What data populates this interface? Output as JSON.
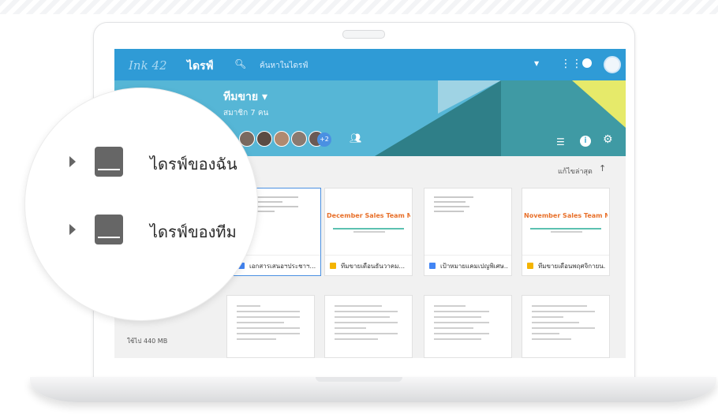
{
  "topbar": {
    "logo_text": "Ink 42",
    "app_title": "ไดรฟ์",
    "search_placeholder": "ค้นหาในไดรฟ์"
  },
  "banner": {
    "team_name": "ทีมขาย ▾",
    "member_count": "สมาชิก 7 คน",
    "extra_members_badge": "+2"
  },
  "sort": {
    "label": "แก้ไขล่าสุด",
    "direction_icon": "arrow-up-icon"
  },
  "magnifier": {
    "items": [
      {
        "label": "ไดรฟ์ของฉัน",
        "icon": "my-drive-icon"
      },
      {
        "label": "ไดรฟ์ของทีม",
        "icon": "team-drive-icon"
      }
    ]
  },
  "files_row1": [
    {
      "name": "เอกสารเสนอฯประชาฯ...",
      "type": "docs",
      "thumb_title": ""
    },
    {
      "name": "ทีมขายเดือนธันวาคม...",
      "type": "slides",
      "thumb_title": "December Sales Team Meeting"
    },
    {
      "name": "เป้าหมายแคมเปญพิเศษ...",
      "type": "docs",
      "thumb_title": ""
    },
    {
      "name": "ทีมขายเดือนพฤศจิกายน...",
      "type": "slides",
      "thumb_title": "November Sales Team Meeting"
    }
  ],
  "storage": {
    "label": "ใช้ไป 440 MB"
  },
  "colors": {
    "topbar": "#2f9bd6",
    "banner": "#56b6d6",
    "accent_orange": "#e8702a",
    "accent_yellow": "#e6ea6a",
    "selection": "#4a90e2"
  }
}
